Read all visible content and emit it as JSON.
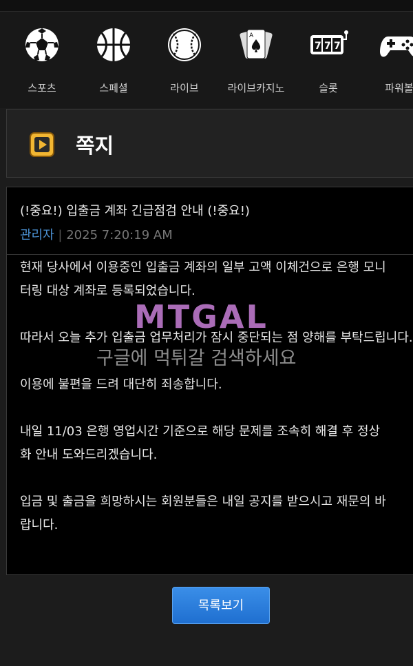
{
  "nav": {
    "items": [
      {
        "label": "스포츠",
        "icon": "soccer-ball-icon"
      },
      {
        "label": "스페셜",
        "icon": "basketball-icon"
      },
      {
        "label": "라이브",
        "icon": "baseball-icon"
      },
      {
        "label": "라이브카지노",
        "icon": "playing-cards-icon"
      },
      {
        "label": "슬롯",
        "icon": "slot-machine-icon"
      },
      {
        "label": "파워볼",
        "icon": "gamepad-icon"
      }
    ]
  },
  "page": {
    "title": "쪽지",
    "title_icon": "play-square-icon"
  },
  "message": {
    "title": "(!중요!) 입출금 계좌 긴급점검 안내 (!중요!)",
    "author": "관리자",
    "separator": "|",
    "date": "2025 7:20:19 AM",
    "paragraphs": [
      [
        "현재 당사에서 이용중인 입출금 계좌의 일부 고액 이체건으로 은행 모니",
        "터링 대상 계좌로 등록되었습니다."
      ],
      [
        "따라서 오늘 추가 입출금 업무처리가 잠시 중단되는 점 양해를 부탁드립니다."
      ],
      [
        "이용에 불편을 드려 대단히 죄송합니다."
      ],
      [
        "내일 11/03 은행 영업시간 기준으로 해당 문제를 조속히 해결 후 정상",
        "화 안내 도와드리겠습니다."
      ],
      [
        "입금 및 출금을 희망하시는 회원분들은 내일 공지를 받으시고 재문의 바",
        "랍니다."
      ]
    ]
  },
  "watermark": {
    "logo": "MTGAL",
    "text": "구글에 먹튀갈 검색하세요"
  },
  "buttons": {
    "list_label": "목록보기"
  },
  "colors": {
    "accent_blue": "#2a7fe0",
    "author": "#4a8fd0",
    "icon_gold": "#e0a526"
  }
}
